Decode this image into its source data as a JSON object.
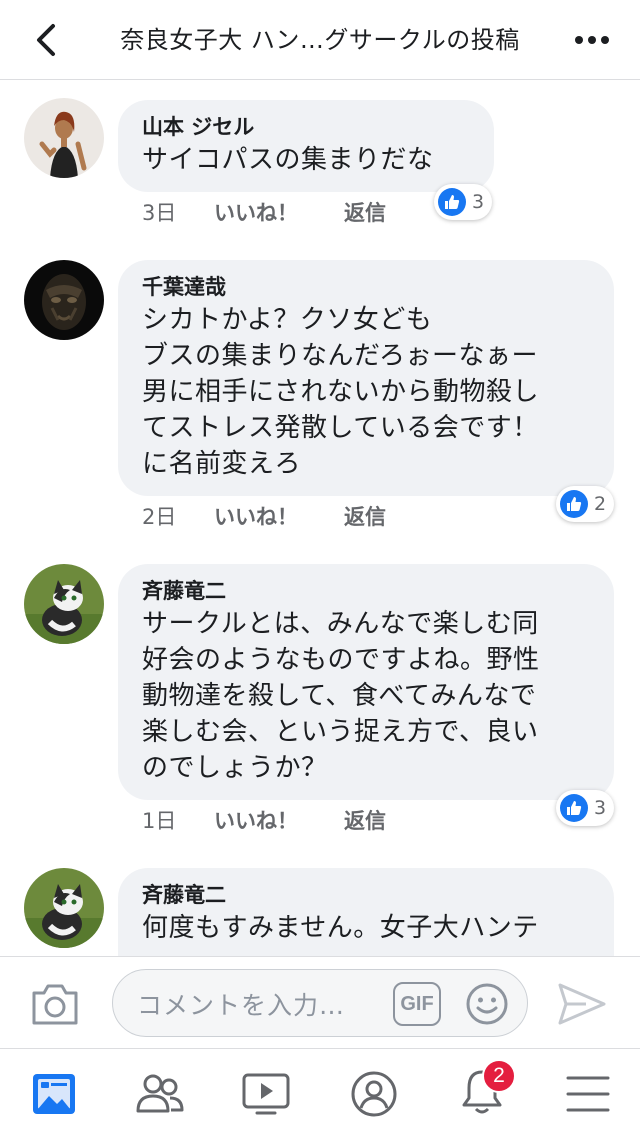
{
  "header": {
    "title": "奈良女子大 ハン…グサークルの投稿"
  },
  "comments": [
    {
      "author": "山本 ジセル",
      "text": "サイコパスの集まりだな",
      "time": "3日",
      "like_label": "いいね！",
      "reply_label": "返信",
      "reactions": "3"
    },
    {
      "author": "千葉達哉",
      "text": "シカトかよ？クソ女ども\nブスの集まりなんだろぉーなぁー\n男に相手にされないから動物殺し\nてストレス発散している会です！\nに名前変えろ",
      "time": "2日",
      "like_label": "いいね！",
      "reply_label": "返信",
      "reactions": "2"
    },
    {
      "author": "斉藤竜二",
      "text": "サークルとは、みんなで楽しむ同\n好会のようなものですよね。野性\n動物達を殺して、食べてみんなで\n楽しむ会、という捉え方で、良い\nのでしょうか？",
      "time": "1日",
      "like_label": "いいね！",
      "reply_label": "返信",
      "reactions": "3"
    },
    {
      "author": "斉藤竜二",
      "text": "何度もすみません。女子大ハンテ"
    }
  ],
  "input": {
    "placeholder": "コメントを入力…",
    "gif_label": "GIF"
  },
  "nav": {
    "notifications_badge": "2"
  },
  "colors": {
    "accent": "#1877f2",
    "bubble": "#f0f2f5",
    "badge": "#e41e3f",
    "secondary_text": "#65676b"
  },
  "icons": [
    "back-arrow-icon",
    "more-icon",
    "like-icon",
    "camera-icon",
    "gif-icon",
    "emoji-icon",
    "send-icon",
    "news-feed-icon",
    "friends-icon",
    "watch-icon",
    "profile-icon",
    "bell-icon",
    "menu-icon"
  ]
}
